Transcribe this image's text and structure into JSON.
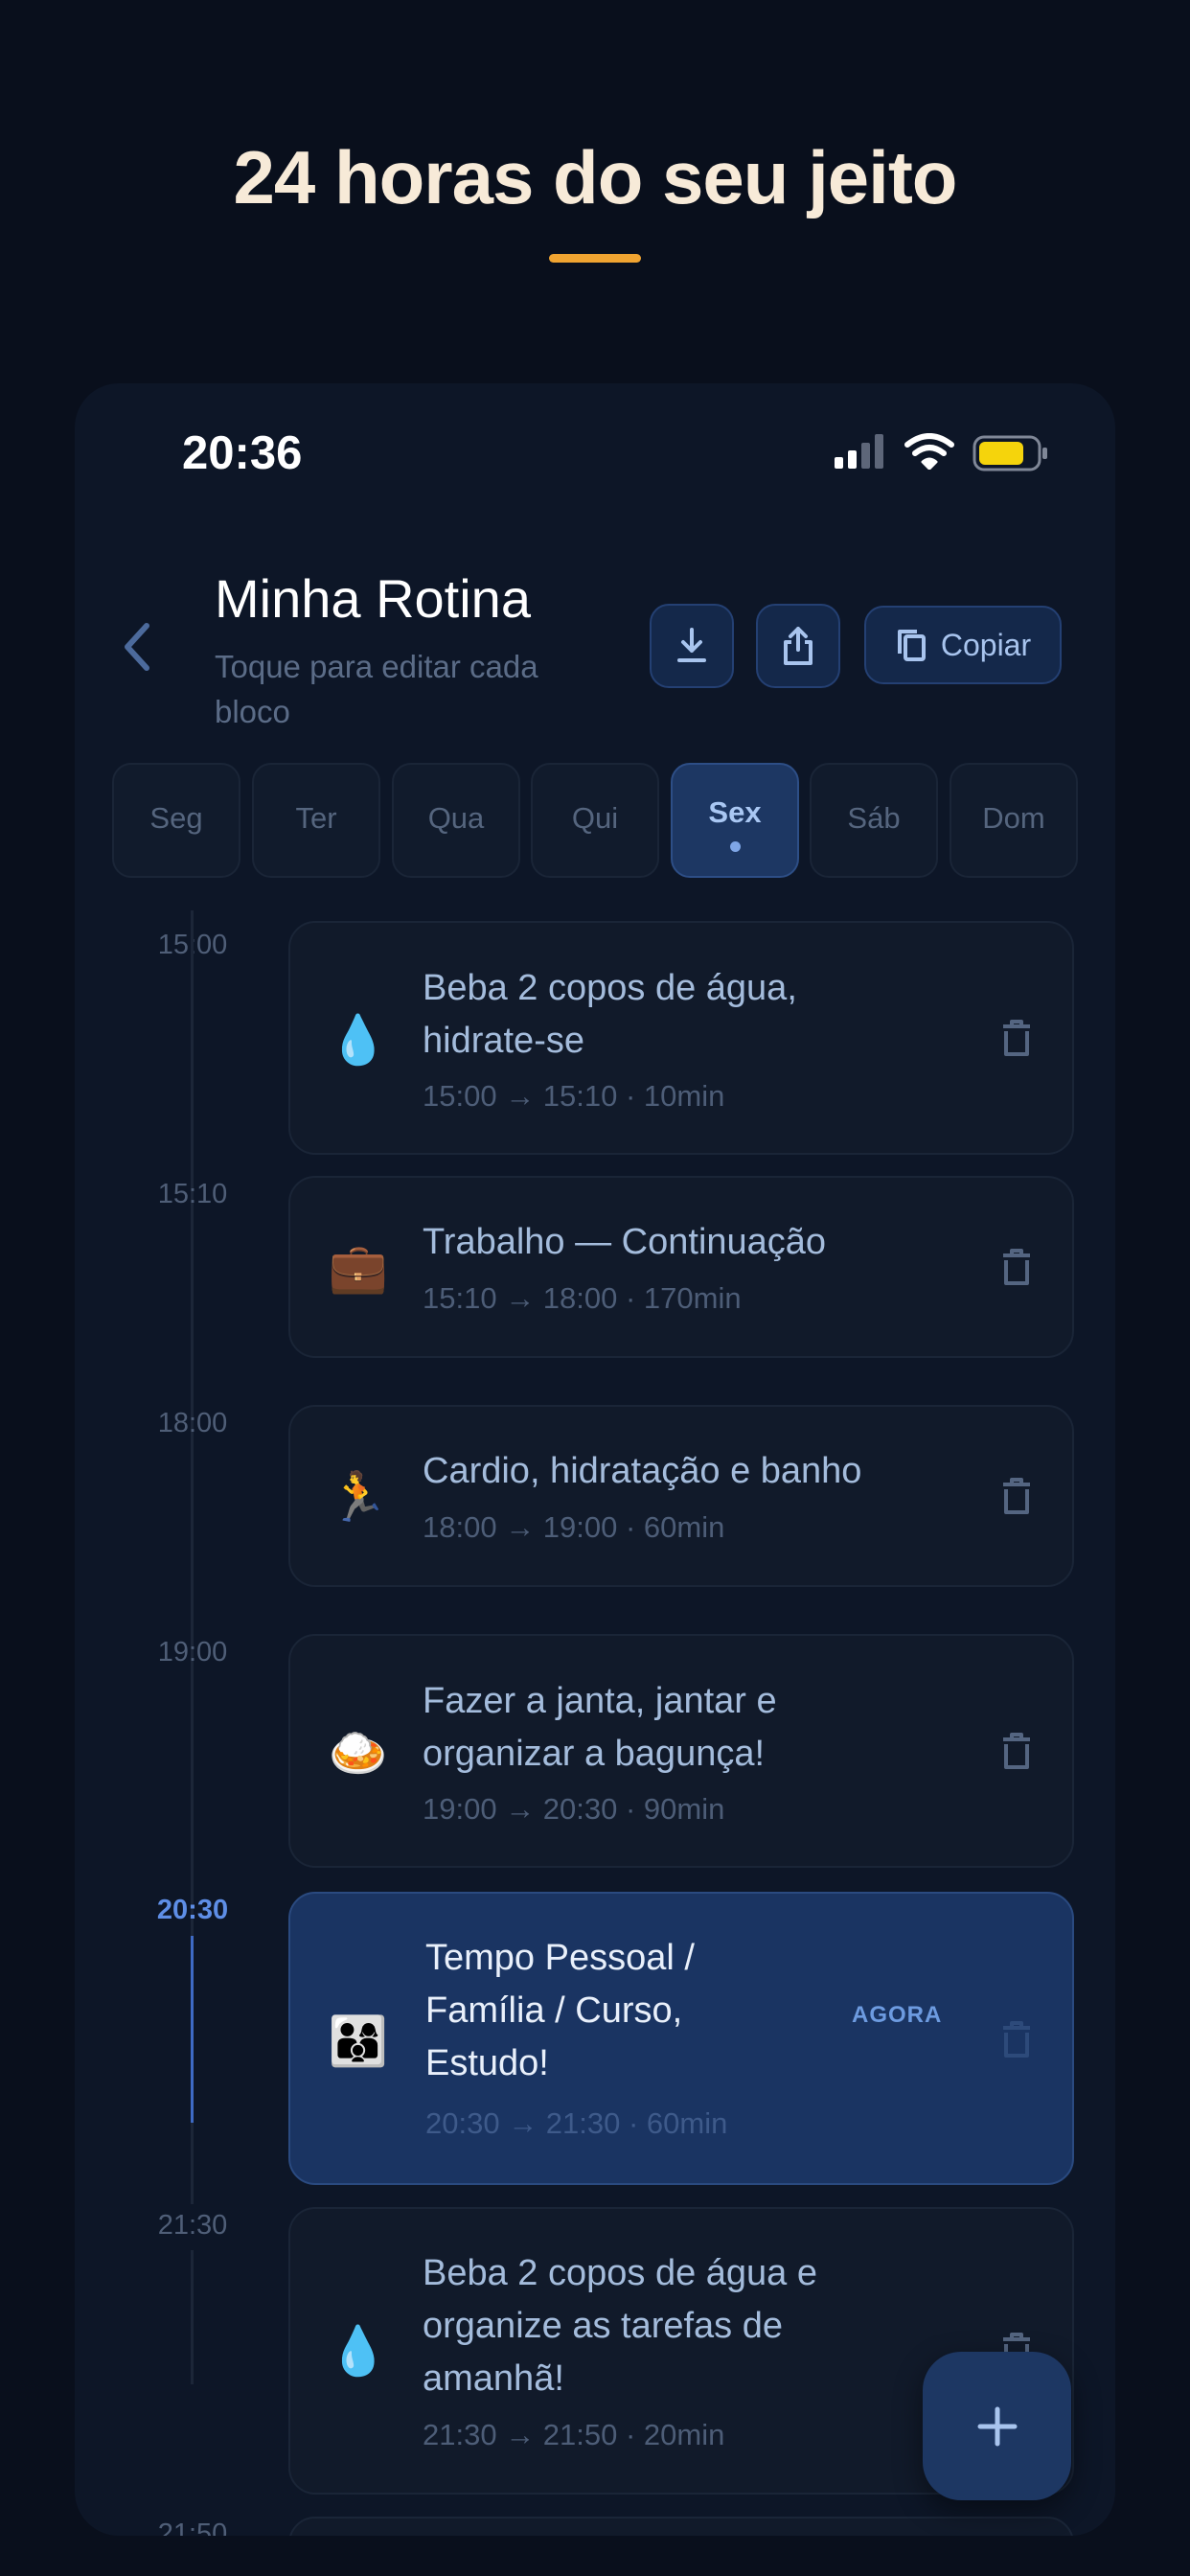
{
  "headline": "24 horas do seu jeito",
  "status": {
    "time": "20:36"
  },
  "header": {
    "title": "Minha Rotina",
    "subtitle": "Toque para editar cada bloco",
    "copy_label": "Copiar"
  },
  "days": [
    {
      "label": "Seg"
    },
    {
      "label": "Ter"
    },
    {
      "label": "Qua"
    },
    {
      "label": "Qui"
    },
    {
      "label": "Sex",
      "active": true
    },
    {
      "label": "Sáb"
    },
    {
      "label": "Dom"
    }
  ],
  "blocks": [
    {
      "time": "15:00",
      "emoji": "💧",
      "title": "Beba 2 copos de água, hidrate-se",
      "meta": "15:00 → 15:10 · 10min"
    },
    {
      "time": "15:10",
      "emoji": "💼",
      "title": "Trabalho — Continuação",
      "meta": "15:10 → 18:00 · 170min"
    },
    {
      "time": "18:00",
      "emoji": "🏃",
      "title": "Cardio, hidratação e banho",
      "meta": "18:00 → 19:00 · 60min"
    },
    {
      "time": "19:00",
      "emoji": "🍛",
      "title": "Fazer a janta, jantar e organizar a bagunça!",
      "meta": "19:00 → 20:30 · 90min"
    },
    {
      "time": "20:30",
      "emoji": "👨‍👩‍👦",
      "title": "Tempo Pessoal / Família / Curso, Estudo!",
      "meta": "20:30 → 21:30 · 60min",
      "badge": "AGORA",
      "current": true
    },
    {
      "time": "21:30",
      "emoji": "💧",
      "title": "Beba 2 copos de água e organize as tarefas de amanhã!",
      "meta": "21:30 → 21:50 · 20min"
    }
  ],
  "next_time": "21:50",
  "colors": {
    "accent": "#f0a431",
    "primary": "#1d3763",
    "background": "#090f1c"
  }
}
